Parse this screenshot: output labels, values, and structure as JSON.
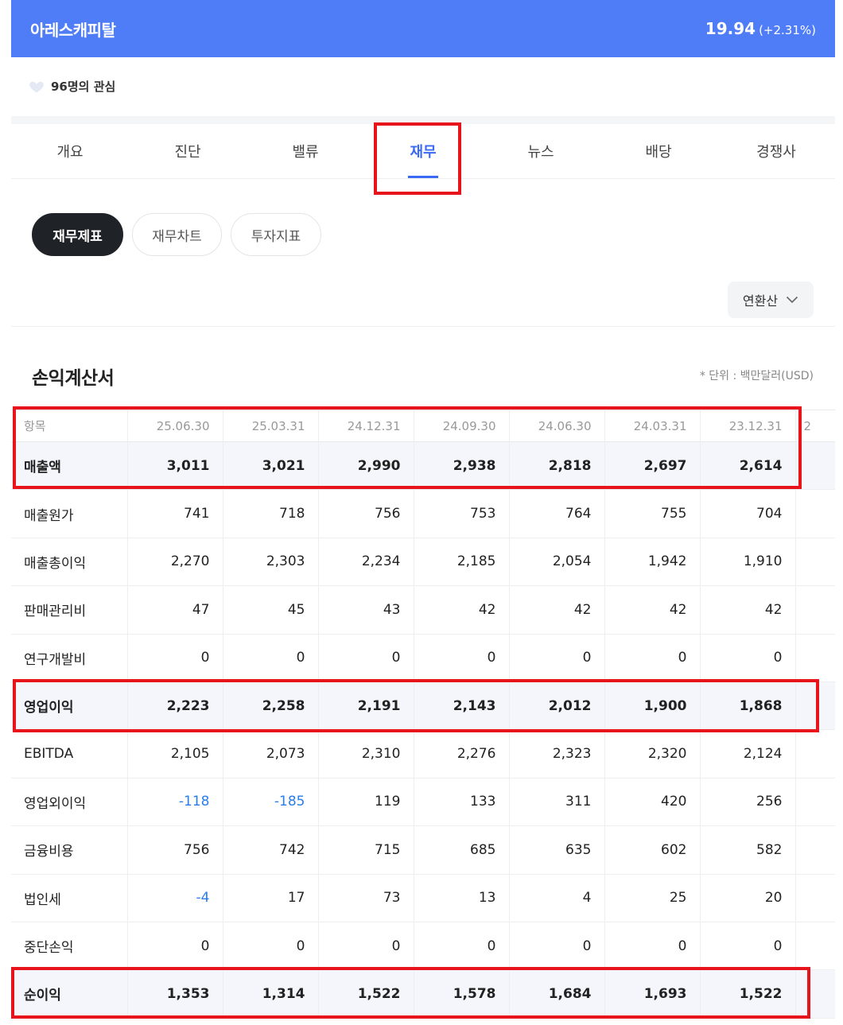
{
  "header": {
    "company": "아레스캐피탈",
    "price": "19.94",
    "change": "(+2.31%)"
  },
  "interest": {
    "icon": "heart-icon",
    "text": "96명의 관심"
  },
  "tabs": [
    {
      "label": "개요"
    },
    {
      "label": "진단"
    },
    {
      "label": "밸류"
    },
    {
      "label": "재무",
      "active": true
    },
    {
      "label": "뉴스"
    },
    {
      "label": "배당"
    },
    {
      "label": "경쟁사"
    }
  ],
  "subtabs": [
    {
      "label": "재무제표",
      "active": true
    },
    {
      "label": "재무차트"
    },
    {
      "label": "투자지표"
    }
  ],
  "dropdown": {
    "selected": "연환산",
    "icon": "chevron-down-icon"
  },
  "section": {
    "title": "손익계산서",
    "unit": "* 단위 : 백만달러(USD)"
  },
  "table": {
    "headers": [
      "항목",
      "25.06.30",
      "25.03.31",
      "24.12.31",
      "24.09.30",
      "24.06.30",
      "24.03.31",
      "23.12.31",
      "2"
    ],
    "rows": [
      {
        "label": "매출액",
        "values": [
          "3,011",
          "3,021",
          "2,990",
          "2,938",
          "2,818",
          "2,697",
          "2,614",
          ""
        ],
        "highlight": true
      },
      {
        "label": "매출원가",
        "values": [
          "741",
          "718",
          "756",
          "753",
          "764",
          "755",
          "704",
          ""
        ]
      },
      {
        "label": "매출총이익",
        "values": [
          "2,270",
          "2,303",
          "2,234",
          "2,185",
          "2,054",
          "1,942",
          "1,910",
          ""
        ]
      },
      {
        "label": "판매관리비",
        "values": [
          "47",
          "45",
          "43",
          "42",
          "42",
          "42",
          "42",
          ""
        ]
      },
      {
        "label": "연구개발비",
        "values": [
          "0",
          "0",
          "0",
          "0",
          "0",
          "0",
          "0",
          ""
        ]
      },
      {
        "label": "영업이익",
        "values": [
          "2,223",
          "2,258",
          "2,191",
          "2,143",
          "2,012",
          "1,900",
          "1,868",
          ""
        ],
        "highlight": true
      },
      {
        "label": "EBITDA",
        "values": [
          "2,105",
          "2,073",
          "2,310",
          "2,276",
          "2,323",
          "2,320",
          "2,124",
          ""
        ]
      },
      {
        "label": "영업외이익",
        "values": [
          "-118",
          "-185",
          "119",
          "133",
          "311",
          "420",
          "256",
          ""
        ]
      },
      {
        "label": "금융비용",
        "values": [
          "756",
          "742",
          "715",
          "685",
          "635",
          "602",
          "582",
          ""
        ]
      },
      {
        "label": "법인세",
        "values": [
          "-4",
          "17",
          "73",
          "13",
          "4",
          "25",
          "20",
          ""
        ]
      },
      {
        "label": "중단손익",
        "values": [
          "0",
          "0",
          "0",
          "0",
          "0",
          "0",
          "0",
          ""
        ]
      },
      {
        "label": "순이익",
        "values": [
          "1,353",
          "1,314",
          "1,522",
          "1,578",
          "1,684",
          "1,693",
          "1,522",
          ""
        ],
        "highlight": true
      }
    ]
  },
  "colors": {
    "header_bg": "#4f7cf7",
    "active_tab": "#3a6af5",
    "negative": "#2b7de9",
    "annotation": "#e8141b"
  }
}
